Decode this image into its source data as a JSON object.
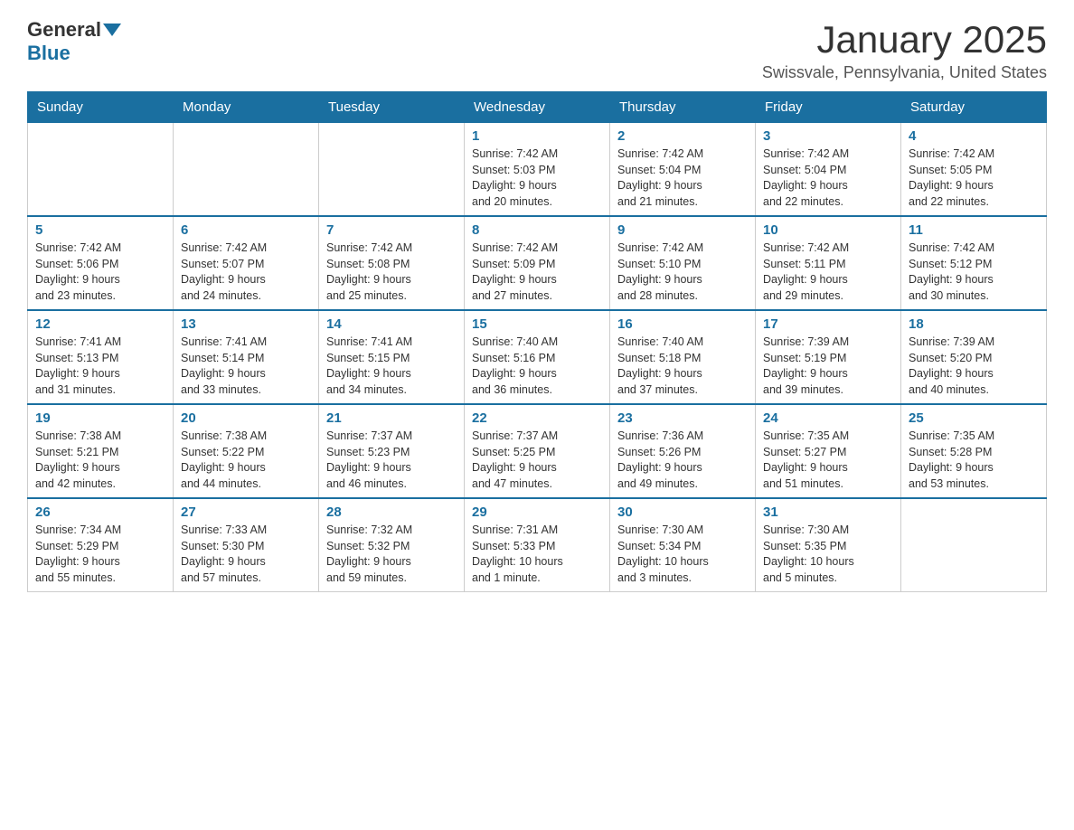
{
  "header": {
    "logo": {
      "general": "General",
      "blue": "Blue"
    },
    "title": "January 2025",
    "subtitle": "Swissvale, Pennsylvania, United States"
  },
  "weekdays": [
    "Sunday",
    "Monday",
    "Tuesday",
    "Wednesday",
    "Thursday",
    "Friday",
    "Saturday"
  ],
  "weeks": [
    [
      {
        "day": "",
        "info": ""
      },
      {
        "day": "",
        "info": ""
      },
      {
        "day": "",
        "info": ""
      },
      {
        "day": "1",
        "info": "Sunrise: 7:42 AM\nSunset: 5:03 PM\nDaylight: 9 hours\nand 20 minutes."
      },
      {
        "day": "2",
        "info": "Sunrise: 7:42 AM\nSunset: 5:04 PM\nDaylight: 9 hours\nand 21 minutes."
      },
      {
        "day": "3",
        "info": "Sunrise: 7:42 AM\nSunset: 5:04 PM\nDaylight: 9 hours\nand 22 minutes."
      },
      {
        "day": "4",
        "info": "Sunrise: 7:42 AM\nSunset: 5:05 PM\nDaylight: 9 hours\nand 22 minutes."
      }
    ],
    [
      {
        "day": "5",
        "info": "Sunrise: 7:42 AM\nSunset: 5:06 PM\nDaylight: 9 hours\nand 23 minutes."
      },
      {
        "day": "6",
        "info": "Sunrise: 7:42 AM\nSunset: 5:07 PM\nDaylight: 9 hours\nand 24 minutes."
      },
      {
        "day": "7",
        "info": "Sunrise: 7:42 AM\nSunset: 5:08 PM\nDaylight: 9 hours\nand 25 minutes."
      },
      {
        "day": "8",
        "info": "Sunrise: 7:42 AM\nSunset: 5:09 PM\nDaylight: 9 hours\nand 27 minutes."
      },
      {
        "day": "9",
        "info": "Sunrise: 7:42 AM\nSunset: 5:10 PM\nDaylight: 9 hours\nand 28 minutes."
      },
      {
        "day": "10",
        "info": "Sunrise: 7:42 AM\nSunset: 5:11 PM\nDaylight: 9 hours\nand 29 minutes."
      },
      {
        "day": "11",
        "info": "Sunrise: 7:42 AM\nSunset: 5:12 PM\nDaylight: 9 hours\nand 30 minutes."
      }
    ],
    [
      {
        "day": "12",
        "info": "Sunrise: 7:41 AM\nSunset: 5:13 PM\nDaylight: 9 hours\nand 31 minutes."
      },
      {
        "day": "13",
        "info": "Sunrise: 7:41 AM\nSunset: 5:14 PM\nDaylight: 9 hours\nand 33 minutes."
      },
      {
        "day": "14",
        "info": "Sunrise: 7:41 AM\nSunset: 5:15 PM\nDaylight: 9 hours\nand 34 minutes."
      },
      {
        "day": "15",
        "info": "Sunrise: 7:40 AM\nSunset: 5:16 PM\nDaylight: 9 hours\nand 36 minutes."
      },
      {
        "day": "16",
        "info": "Sunrise: 7:40 AM\nSunset: 5:18 PM\nDaylight: 9 hours\nand 37 minutes."
      },
      {
        "day": "17",
        "info": "Sunrise: 7:39 AM\nSunset: 5:19 PM\nDaylight: 9 hours\nand 39 minutes."
      },
      {
        "day": "18",
        "info": "Sunrise: 7:39 AM\nSunset: 5:20 PM\nDaylight: 9 hours\nand 40 minutes."
      }
    ],
    [
      {
        "day": "19",
        "info": "Sunrise: 7:38 AM\nSunset: 5:21 PM\nDaylight: 9 hours\nand 42 minutes."
      },
      {
        "day": "20",
        "info": "Sunrise: 7:38 AM\nSunset: 5:22 PM\nDaylight: 9 hours\nand 44 minutes."
      },
      {
        "day": "21",
        "info": "Sunrise: 7:37 AM\nSunset: 5:23 PM\nDaylight: 9 hours\nand 46 minutes."
      },
      {
        "day": "22",
        "info": "Sunrise: 7:37 AM\nSunset: 5:25 PM\nDaylight: 9 hours\nand 47 minutes."
      },
      {
        "day": "23",
        "info": "Sunrise: 7:36 AM\nSunset: 5:26 PM\nDaylight: 9 hours\nand 49 minutes."
      },
      {
        "day": "24",
        "info": "Sunrise: 7:35 AM\nSunset: 5:27 PM\nDaylight: 9 hours\nand 51 minutes."
      },
      {
        "day": "25",
        "info": "Sunrise: 7:35 AM\nSunset: 5:28 PM\nDaylight: 9 hours\nand 53 minutes."
      }
    ],
    [
      {
        "day": "26",
        "info": "Sunrise: 7:34 AM\nSunset: 5:29 PM\nDaylight: 9 hours\nand 55 minutes."
      },
      {
        "day": "27",
        "info": "Sunrise: 7:33 AM\nSunset: 5:30 PM\nDaylight: 9 hours\nand 57 minutes."
      },
      {
        "day": "28",
        "info": "Sunrise: 7:32 AM\nSunset: 5:32 PM\nDaylight: 9 hours\nand 59 minutes."
      },
      {
        "day": "29",
        "info": "Sunrise: 7:31 AM\nSunset: 5:33 PM\nDaylight: 10 hours\nand 1 minute."
      },
      {
        "day": "30",
        "info": "Sunrise: 7:30 AM\nSunset: 5:34 PM\nDaylight: 10 hours\nand 3 minutes."
      },
      {
        "day": "31",
        "info": "Sunrise: 7:30 AM\nSunset: 5:35 PM\nDaylight: 10 hours\nand 5 minutes."
      },
      {
        "day": "",
        "info": ""
      }
    ]
  ]
}
